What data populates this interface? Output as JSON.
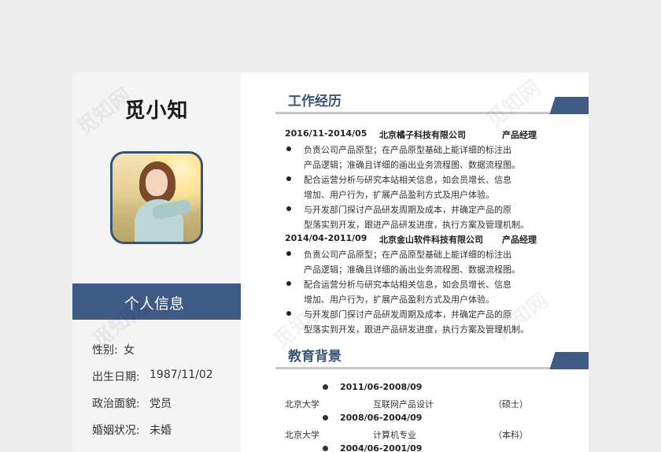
{
  "resume": {
    "name": "觅小知",
    "photo_icon": "profile-photo",
    "personal_info": {
      "title": "个人信息",
      "rows": [
        {
          "label": "性别:",
          "value": "女"
        },
        {
          "label": "出生日期:",
          "value": "1987/11/02"
        },
        {
          "label": "政治面貌:",
          "value": "党员"
        },
        {
          "label": "婚姻状况:",
          "value": "未婚"
        }
      ]
    },
    "work": {
      "title": "工作经历",
      "jobs": [
        {
          "period": "2016/11-2014/05",
          "company": "北京橘子科技有限公司",
          "role": "产品经理",
          "bullets": [
            [
              "负责公司产品原型；在产品原型基础上能详细的标注出",
              "产品逻辑；准确且详细的画出业务流程图、数据流程图。"
            ],
            [
              "配合运营分析与研究本站相关信息，如会员增长、信息",
              "增加、用户行为，扩展产品盈利方式及用户体验。"
            ],
            [
              "与开发部门探讨产品研发周期及成本，并确定产品的原",
              "型落实到开发，跟进产品研发进度，执行方案及管理机制。"
            ]
          ]
        },
        {
          "period": "2014/04-2011/09",
          "company": "北京金山软件科技有限公司",
          "role": "产品经理",
          "bullets": [
            [
              "负责公司产品原型；在产品原型基础上能详细的标注出",
              "产品逻辑；准确且详细的画出业务流程图、数据流程图。"
            ],
            [
              "配合运营分析与研究本站相关信息，如会员增长、信息",
              "增加、用户行为，扩展产品盈利方式及用户体验。"
            ],
            [
              "与开发部门探讨产品研发周期及成本，并确定产品的原",
              "型落实到开发，跟进产品研发进度，执行方案及管理机制。"
            ]
          ]
        }
      ]
    },
    "education": {
      "title": "教育背景",
      "entries": [
        {
          "period": "2011/06-2008/09",
          "school": "北京大学",
          "major": "互联网产品设计",
          "degree": "（硕士）"
        },
        {
          "period": "2008/06-2004/09",
          "school": "北京大学",
          "major": "计算机专业",
          "degree": "（本科）"
        },
        {
          "period": "2004/06-2001/09",
          "school": "",
          "major": "",
          "degree": ""
        }
      ]
    },
    "watermark": "觅知网",
    "colors": {
      "accent": "#3f5a84",
      "background": "#ededed"
    }
  }
}
